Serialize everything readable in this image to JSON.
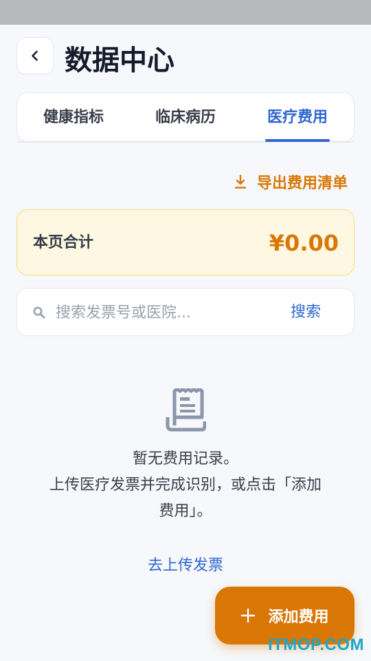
{
  "header": {
    "title": "数据中心"
  },
  "tabs": [
    {
      "label": "健康指标",
      "active": false
    },
    {
      "label": "临床病历",
      "active": false
    },
    {
      "label": "医疗费用",
      "active": true
    }
  ],
  "export": {
    "label": "导出费用清单",
    "icon": "download-icon"
  },
  "summary": {
    "label": "本页合计",
    "value": "¥0.00"
  },
  "search": {
    "placeholder": "搜索发票号或医院...",
    "value": "",
    "button_label": "搜索"
  },
  "empty_state": {
    "icon": "receipt-icon",
    "line1": "暂无费用记录。",
    "line2": "上传医疗发票并完成识别，或点击「添加",
    "line3": "费用」。",
    "upload_link": "去上传发票"
  },
  "fab": {
    "label": "添加费用",
    "icon": "plus-icon"
  },
  "watermark": "ITMOP.COM",
  "colors": {
    "accent_blue": "#2f66d0",
    "accent_orange": "#d97706",
    "summary_bg": "#fef8e3"
  }
}
